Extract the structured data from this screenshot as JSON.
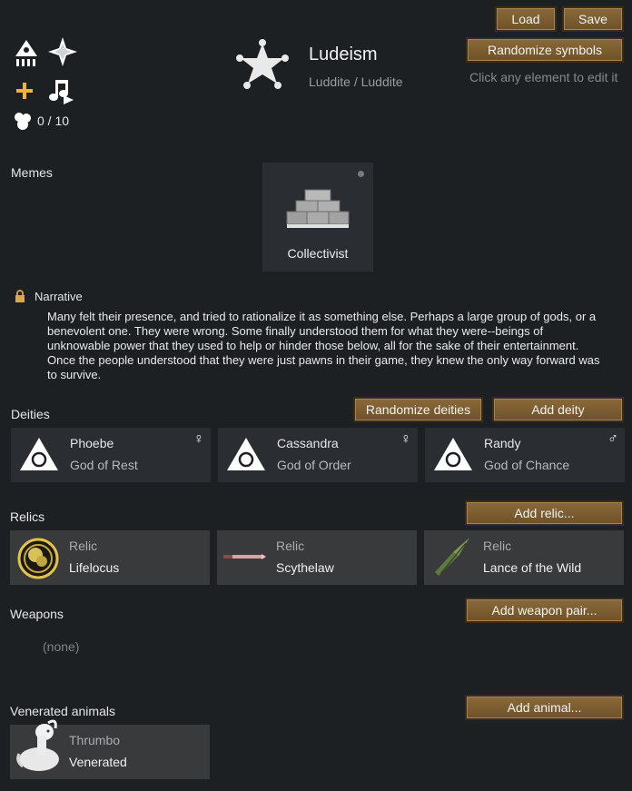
{
  "header": {
    "load_label": "Load",
    "save_label": "Save",
    "randomize_symbols_label": "Randomize symbols",
    "hint": "Click any element to edit it",
    "ideo_name": "Ludeism",
    "ideo_adjective": "Luddite / Luddite",
    "counter": "0 / 10"
  },
  "memes": {
    "label": "Memes",
    "items": [
      {
        "name": "Collectivist",
        "icon": "bricks-icon"
      }
    ]
  },
  "narrative": {
    "label": "Narrative",
    "text": "Many felt their presence, and tried to rationalize it as something else. Perhaps a large group of gods, or a benevolent one. They were wrong. Some finally understood them for what they were--beings of unknowable power that they used to help or hinder those below, all for the sake of their entertainment. Once the people understood that they were just pawns in their game, they knew the only way forward was to survive."
  },
  "deities": {
    "label": "Deities",
    "randomize_label": "Randomize deities",
    "add_label": "Add deity",
    "items": [
      {
        "name": "Phoebe",
        "title": "God of Rest",
        "gender": "♀"
      },
      {
        "name": "Cassandra",
        "title": "God of Order",
        "gender": "♀"
      },
      {
        "name": "Randy",
        "title": "God of Chance",
        "gender": "♂"
      }
    ]
  },
  "relics": {
    "label": "Relics",
    "add_label": "Add relic...",
    "items": [
      {
        "kind": "Relic",
        "name": "Lifelocus"
      },
      {
        "kind": "Relic",
        "name": "Scythelaw"
      },
      {
        "kind": "Relic",
        "name": "Lance of the Wild"
      }
    ]
  },
  "weapons": {
    "label": "Weapons",
    "add_label": "Add weapon pair...",
    "empty": "(none)"
  },
  "animals": {
    "label": "Venerated animals",
    "add_label": "Add animal...",
    "items": [
      {
        "name": "Thrumbo",
        "status": "Venerated"
      }
    ]
  },
  "colors": {
    "background": "#1d2023",
    "card": "#2a2d31",
    "button": "#7a5c30",
    "accent_yellow": "#f2b233"
  }
}
